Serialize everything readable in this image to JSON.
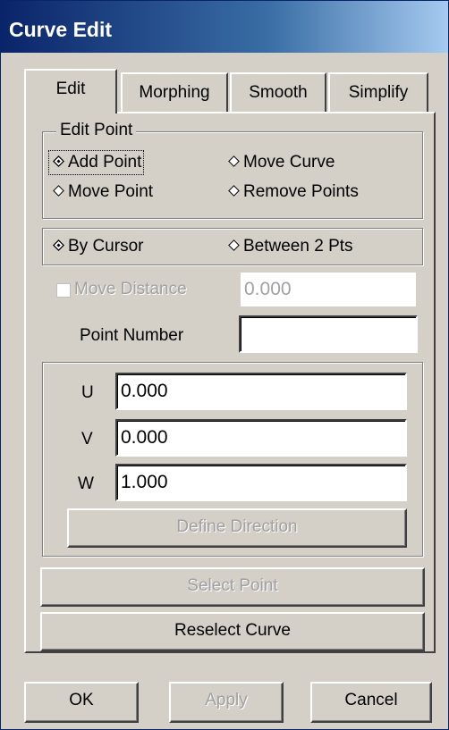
{
  "window": {
    "title": "Curve Edit"
  },
  "tabs": [
    {
      "label": "Edit",
      "active": true
    },
    {
      "label": "Morphing",
      "active": false
    },
    {
      "label": "Smooth",
      "active": false
    },
    {
      "label": "Simplify",
      "active": false
    }
  ],
  "edit_point": {
    "legend": "Edit Point",
    "options": {
      "add_point": "Add Point",
      "move_curve": "Move Curve",
      "move_point": "Move Point",
      "remove_points": "Remove Points"
    },
    "selected": "add_point"
  },
  "mode": {
    "by_cursor": "By Cursor",
    "between_2_pts": "Between 2 Pts",
    "selected": "by_cursor"
  },
  "move_distance": {
    "label": "Move Distance",
    "value": "0.000",
    "checked": false,
    "enabled": false
  },
  "point_number": {
    "label": "Point Number",
    "value": ""
  },
  "direction": {
    "u_label": "U",
    "u_value": "0.000",
    "v_label": "V",
    "v_value": "0.000",
    "w_label": "W",
    "w_value": "1.000",
    "define_direction": "Define Direction"
  },
  "buttons": {
    "select_point": "Select Point",
    "reselect_curve": "Reselect Curve",
    "ok": "OK",
    "apply": "Apply",
    "cancel": "Cancel"
  },
  "colors": {
    "titlebar": "#0a246a",
    "face": "#d4d0c8",
    "disabled_text": "#a0a0a0"
  }
}
